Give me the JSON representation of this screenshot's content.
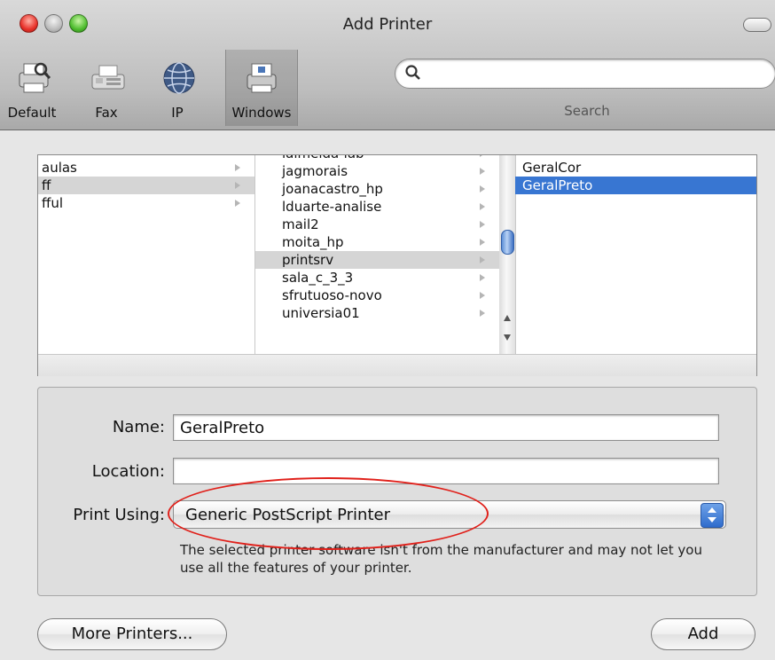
{
  "window": {
    "title": "Add Printer"
  },
  "toolbar": {
    "buttons": [
      {
        "label": "Default",
        "icon": "default-printer-icon"
      },
      {
        "label": "Fax",
        "icon": "fax-icon"
      },
      {
        "label": "IP",
        "icon": "globe-icon"
      },
      {
        "label": "Windows",
        "icon": "windows-printer-icon",
        "selected": true
      }
    ],
    "search_label": "Search",
    "search_value": ""
  },
  "browser": {
    "column1": [
      {
        "label": "aulas"
      },
      {
        "label": "ff",
        "highlighted": true
      },
      {
        "label": "fful"
      }
    ],
    "column2_partial": "lalmeida-lab",
    "column2": [
      {
        "label": "jagmorais"
      },
      {
        "label": "joanacastro_hp"
      },
      {
        "label": "lduarte-analise"
      },
      {
        "label": "mail2"
      },
      {
        "label": "moita_hp"
      },
      {
        "label": "printsrv",
        "highlighted": true
      },
      {
        "label": "sala_c_3_3"
      },
      {
        "label": "sfrutuoso-novo"
      },
      {
        "label": "universia01"
      }
    ],
    "column3": [
      {
        "label": "GeralCor"
      },
      {
        "label": "GeralPreto",
        "selected": true
      }
    ]
  },
  "form": {
    "name_label": "Name:",
    "name_value": "GeralPreto",
    "location_label": "Location:",
    "location_value": "",
    "print_using_label": "Print Using:",
    "print_using_value": "Generic PostScript Printer",
    "note": "The selected printer software isn't from the manufacturer and may not let you use all the features of your printer."
  },
  "buttons": {
    "more_printers": "More Printers...",
    "add": "Add"
  },
  "colors": {
    "selection": "#3876d2",
    "annotation": "#e0201a"
  }
}
